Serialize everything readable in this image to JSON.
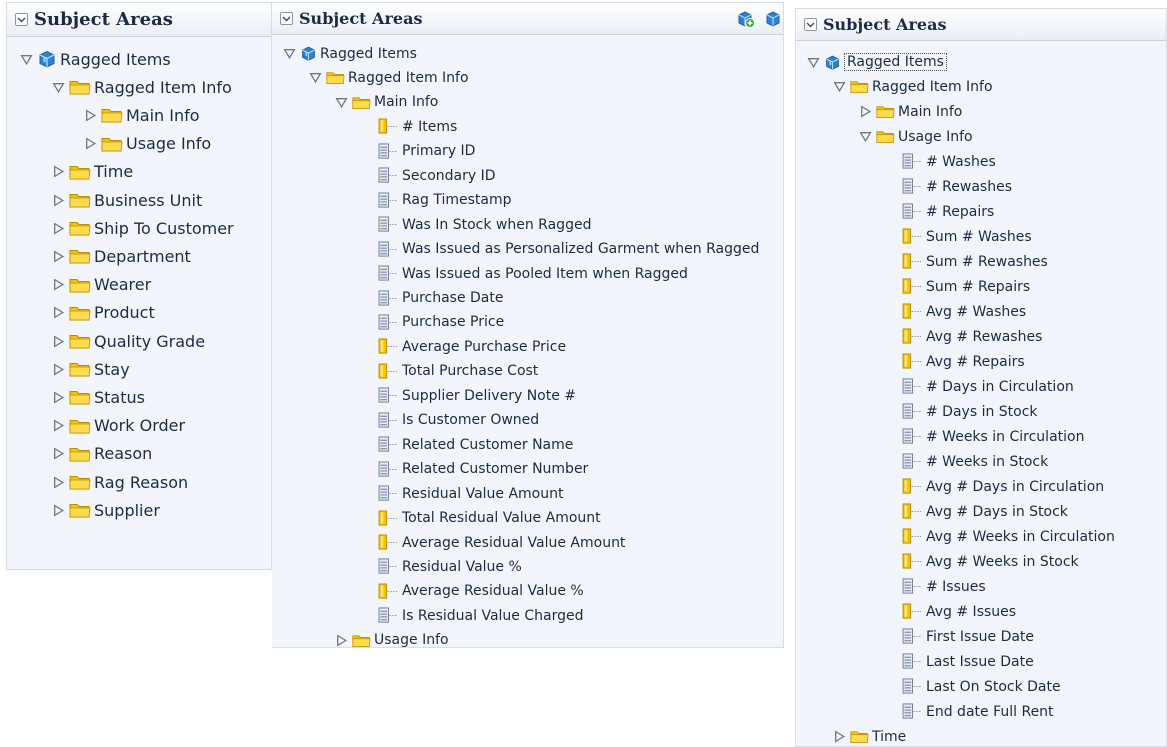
{
  "panels": [
    {
      "id": "p1",
      "title": "Subject Areas",
      "show_header_icons": false,
      "rows": [
        {
          "label": "Ragged Items",
          "level": 0,
          "type": "subject",
          "state": "expanded"
        },
        {
          "label": "Ragged Item Info",
          "level": 1,
          "type": "folder",
          "state": "expanded"
        },
        {
          "label": "Main Info",
          "level": 2,
          "type": "folder",
          "state": "collapsed"
        },
        {
          "label": "Usage Info",
          "level": 2,
          "type": "folder",
          "state": "collapsed"
        },
        {
          "label": "Time",
          "level": 1,
          "type": "folder",
          "state": "collapsed"
        },
        {
          "label": "Business Unit",
          "level": 1,
          "type": "folder",
          "state": "collapsed"
        },
        {
          "label": "Ship To Customer",
          "level": 1,
          "type": "folder",
          "state": "collapsed"
        },
        {
          "label": "Department",
          "level": 1,
          "type": "folder",
          "state": "collapsed"
        },
        {
          "label": "Wearer",
          "level": 1,
          "type": "folder",
          "state": "collapsed"
        },
        {
          "label": "Product",
          "level": 1,
          "type": "folder",
          "state": "collapsed"
        },
        {
          "label": "Quality Grade",
          "level": 1,
          "type": "folder",
          "state": "collapsed"
        },
        {
          "label": "Stay",
          "level": 1,
          "type": "folder",
          "state": "collapsed"
        },
        {
          "label": "Status",
          "level": 1,
          "type": "folder",
          "state": "collapsed"
        },
        {
          "label": "Work Order",
          "level": 1,
          "type": "folder",
          "state": "collapsed"
        },
        {
          "label": "Reason",
          "level": 1,
          "type": "folder",
          "state": "collapsed"
        },
        {
          "label": "Rag Reason",
          "level": 1,
          "type": "folder",
          "state": "collapsed"
        },
        {
          "label": "Supplier",
          "level": 1,
          "type": "folder",
          "state": "collapsed"
        }
      ]
    },
    {
      "id": "p2",
      "title": "Subject Areas",
      "show_header_icons": true,
      "rows": [
        {
          "label": "Ragged Items",
          "level": 0,
          "type": "subject",
          "state": "expanded"
        },
        {
          "label": "Ragged Item Info",
          "level": 1,
          "type": "folder",
          "state": "expanded"
        },
        {
          "label": "Main Info",
          "level": 2,
          "type": "folder",
          "state": "expanded"
        },
        {
          "label": "# Items",
          "level": 3,
          "type": "measure"
        },
        {
          "label": "Primary ID",
          "level": 3,
          "type": "attribute"
        },
        {
          "label": "Secondary ID",
          "level": 3,
          "type": "attribute"
        },
        {
          "label": "Rag Timestamp",
          "level": 3,
          "type": "attribute"
        },
        {
          "label": "Was In Stock when Ragged",
          "level": 3,
          "type": "attribute"
        },
        {
          "label": "Was Issued as Personalized Garment when Ragged",
          "level": 3,
          "type": "attribute"
        },
        {
          "label": "Was Issued as Pooled Item when Ragged",
          "level": 3,
          "type": "attribute"
        },
        {
          "label": "Purchase Date",
          "level": 3,
          "type": "attribute"
        },
        {
          "label": "Purchase Price",
          "level": 3,
          "type": "attribute"
        },
        {
          "label": "Average Purchase Price",
          "level": 3,
          "type": "measure"
        },
        {
          "label": "Total Purchase Cost",
          "level": 3,
          "type": "measure"
        },
        {
          "label": "Supplier Delivery Note #",
          "level": 3,
          "type": "attribute"
        },
        {
          "label": "Is Customer Owned",
          "level": 3,
          "type": "attribute"
        },
        {
          "label": "Related Customer Name",
          "level": 3,
          "type": "attribute"
        },
        {
          "label": "Related Customer Number",
          "level": 3,
          "type": "attribute"
        },
        {
          "label": "Residual Value Amount",
          "level": 3,
          "type": "attribute"
        },
        {
          "label": "Total Residual Value Amount",
          "level": 3,
          "type": "measure"
        },
        {
          "label": "Average Residual Value Amount",
          "level": 3,
          "type": "measure"
        },
        {
          "label": "Residual Value %",
          "level": 3,
          "type": "attribute"
        },
        {
          "label": "Average Residual Value %",
          "level": 3,
          "type": "measure"
        },
        {
          "label": "Is Residual Value Charged",
          "level": 3,
          "type": "attribute"
        },
        {
          "label": "Usage Info",
          "level": 2,
          "type": "folder",
          "state": "collapsed"
        }
      ]
    },
    {
      "id": "p3",
      "title": "Subject Areas",
      "show_header_icons": false,
      "rows": [
        {
          "label": "Ragged Items",
          "level": 0,
          "type": "subject",
          "state": "expanded",
          "selected": true
        },
        {
          "label": "Ragged Item Info",
          "level": 1,
          "type": "folder",
          "state": "expanded"
        },
        {
          "label": "Main Info",
          "level": 2,
          "type": "folder",
          "state": "collapsed"
        },
        {
          "label": "Usage Info",
          "level": 2,
          "type": "folder",
          "state": "expanded"
        },
        {
          "label": "# Washes",
          "level": 3,
          "type": "attribute"
        },
        {
          "label": "# Rewashes",
          "level": 3,
          "type": "attribute"
        },
        {
          "label": "# Repairs",
          "level": 3,
          "type": "attribute"
        },
        {
          "label": "Sum # Washes",
          "level": 3,
          "type": "measure"
        },
        {
          "label": "Sum # Rewashes",
          "level": 3,
          "type": "measure"
        },
        {
          "label": "Sum # Repairs",
          "level": 3,
          "type": "measure"
        },
        {
          "label": "Avg # Washes",
          "level": 3,
          "type": "measure"
        },
        {
          "label": "Avg # Rewashes",
          "level": 3,
          "type": "measure"
        },
        {
          "label": "Avg # Repairs",
          "level": 3,
          "type": "measure"
        },
        {
          "label": "# Days in Circulation",
          "level": 3,
          "type": "attribute"
        },
        {
          "label": "# Days in Stock",
          "level": 3,
          "type": "attribute"
        },
        {
          "label": "# Weeks in Circulation",
          "level": 3,
          "type": "attribute"
        },
        {
          "label": "# Weeks in Stock",
          "level": 3,
          "type": "attribute"
        },
        {
          "label": "Avg # Days in Circulation",
          "level": 3,
          "type": "measure"
        },
        {
          "label": "Avg # Days in Stock",
          "level": 3,
          "type": "measure"
        },
        {
          "label": "Avg # Weeks in Circulation",
          "level": 3,
          "type": "measure"
        },
        {
          "label": "Avg # Weeks in Stock",
          "level": 3,
          "type": "measure"
        },
        {
          "label": "# Issues",
          "level": 3,
          "type": "attribute"
        },
        {
          "label": "Avg # Issues",
          "level": 3,
          "type": "measure"
        },
        {
          "label": "First Issue Date",
          "level": 3,
          "type": "attribute"
        },
        {
          "label": "Last Issue Date",
          "level": 3,
          "type": "attribute"
        },
        {
          "label": "Last On Stock Date",
          "level": 3,
          "type": "attribute"
        },
        {
          "label": "End date Full Rent",
          "level": 3,
          "type": "attribute"
        },
        {
          "label": "Time",
          "level": 1,
          "type": "folder",
          "state": "collapsed"
        }
      ]
    }
  ],
  "icons": {
    "expanded": "triangle-down-icon",
    "collapsed": "triangle-right-icon",
    "subject": "subject-area-cube-icon",
    "folder": "folder-icon",
    "attribute": "attribute-column-icon",
    "measure": "measure-column-icon",
    "header_left": "add-subject-area-icon",
    "header_right": "refresh-icon"
  },
  "colors": {
    "panel_bg": "#f2f5fb",
    "text": "#1b2b46",
    "folder": "#f5c400",
    "measure": "#f3c300",
    "attribute": "#7f8aa8",
    "cube": "#2a83d6"
  }
}
